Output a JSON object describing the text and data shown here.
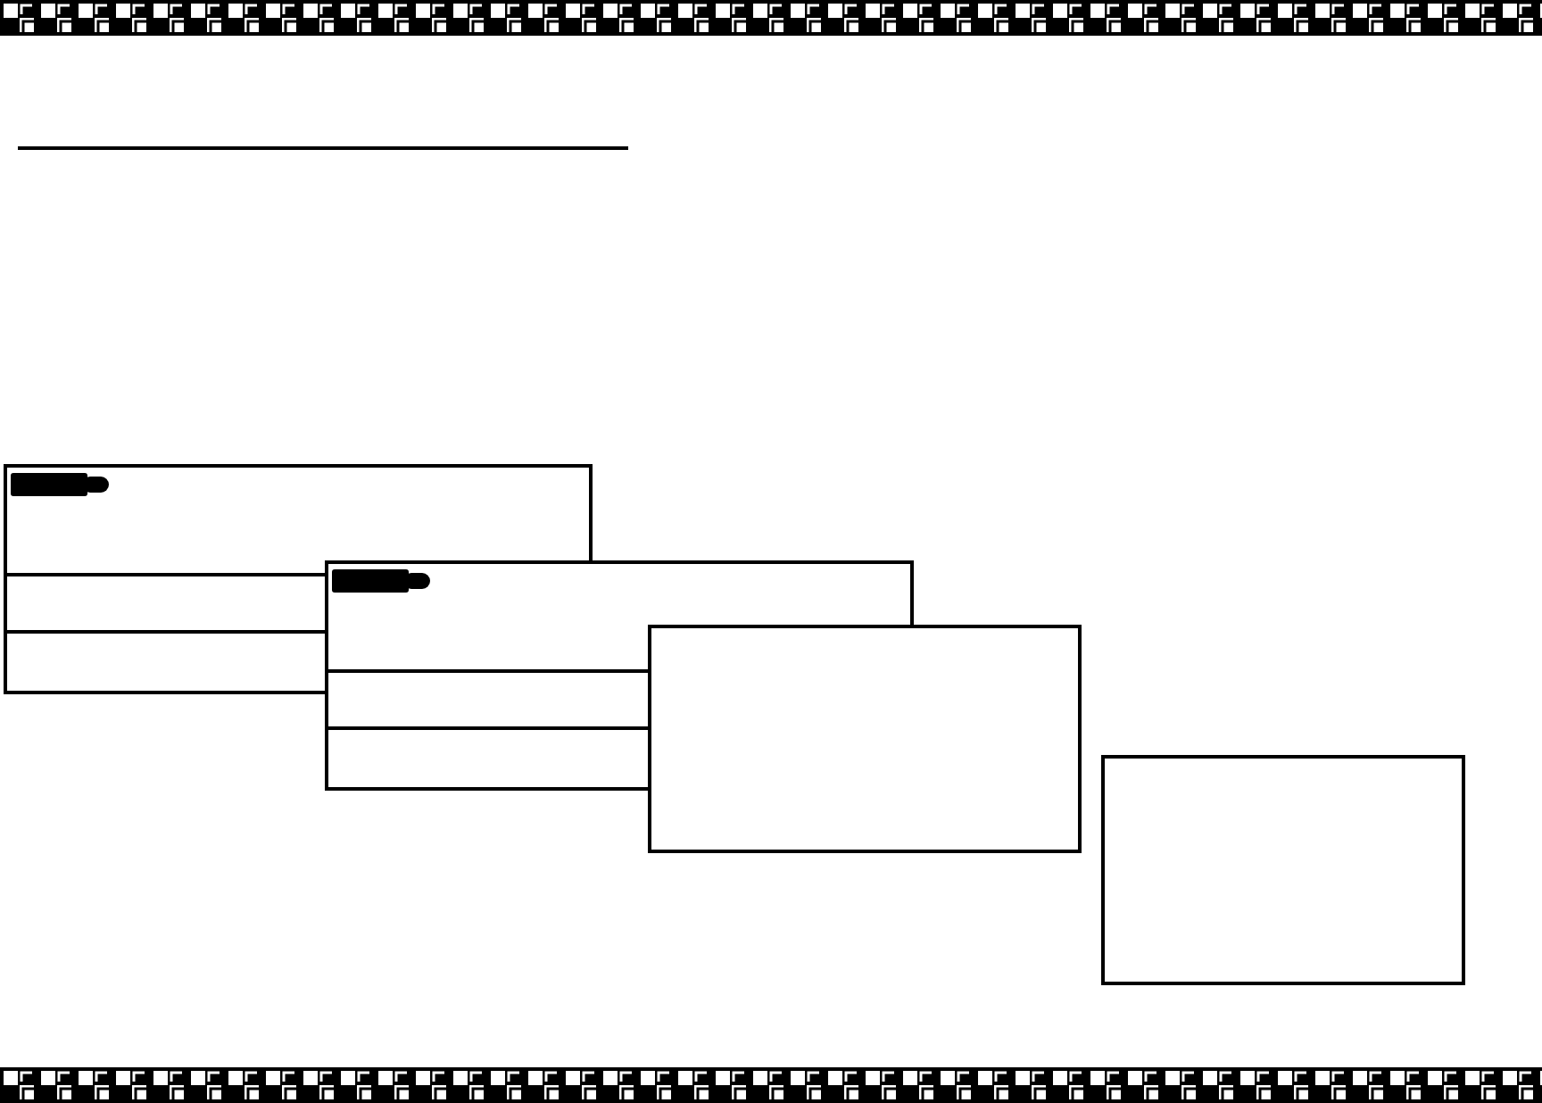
{
  "top_border": {
    "kind": "checkered"
  },
  "heading": {
    "kind": "underline"
  },
  "panels": [
    {
      "kind": "tagged-card"
    },
    {
      "kind": "tagged-card"
    },
    {
      "kind": "blank-box"
    },
    {
      "kind": "blank-box"
    }
  ],
  "bottom_border": {
    "kind": "checkered"
  }
}
